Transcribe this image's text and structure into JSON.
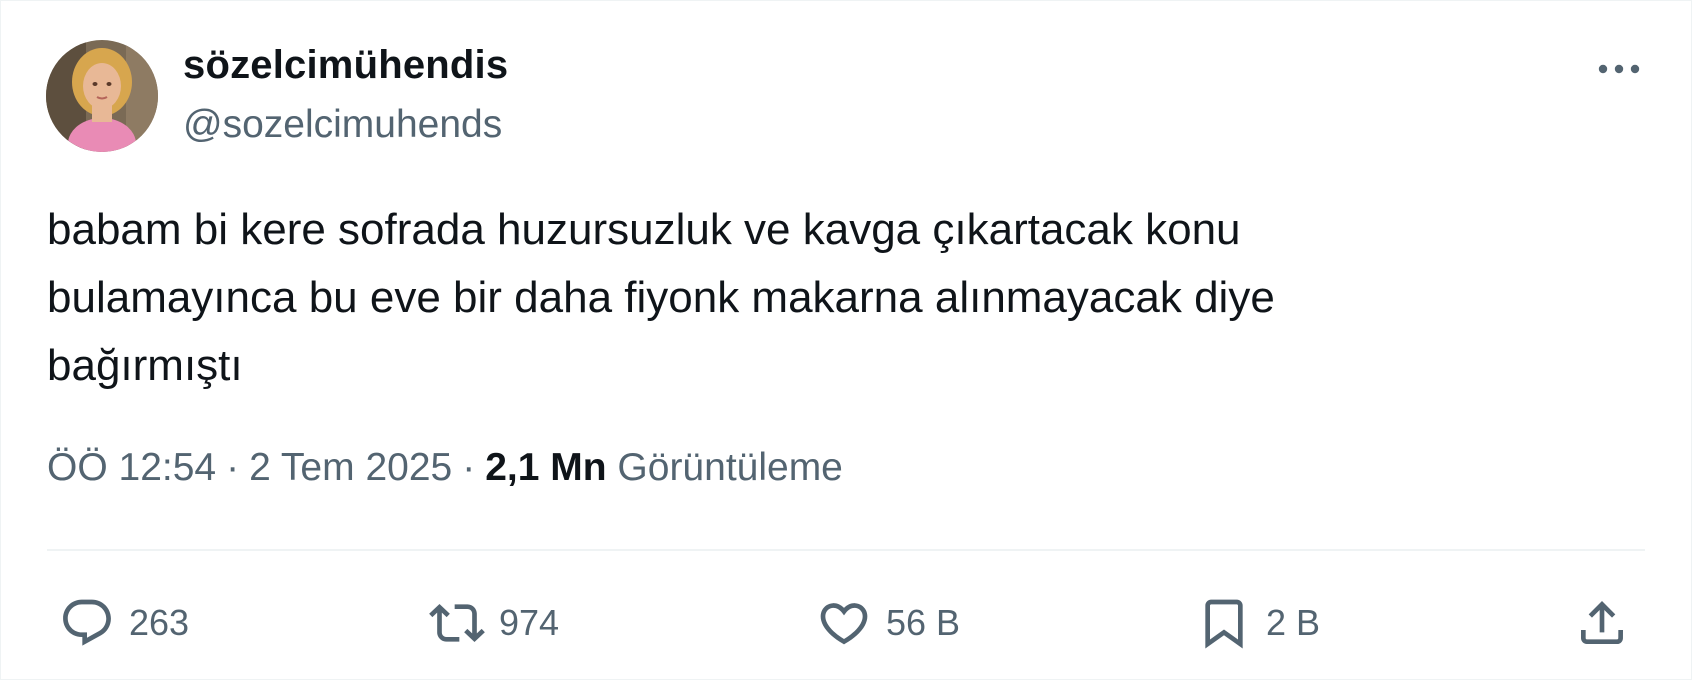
{
  "author": {
    "display_name": "sözelcimühendis",
    "handle": "@sozelcimuhends"
  },
  "tweet": {
    "text_lines": [
      "babam bi kere sofrada huzursuzluk ve kavga çıkartacak konu",
      "bulamayınca bu eve bir daha fiyonk makarna alınmayacak diye",
      "bağırmıştı"
    ],
    "time": "ÖÖ 12:54",
    "date": "2 Tem 2025",
    "separator": "·",
    "views_count": "2,1 Mn",
    "views_label": "Görüntüleme"
  },
  "actions": {
    "replies": "263",
    "reposts": "974",
    "likes": "56 B",
    "bookmarks": "2 B"
  },
  "icons": {
    "more": "more-horizontal-icon",
    "reply": "speech-bubble-icon",
    "repost": "retweet-arrows-icon",
    "like": "heart-icon",
    "bookmark": "bookmark-icon",
    "share": "share-upload-icon"
  },
  "colors": {
    "text_primary": "#0f1419",
    "text_secondary": "#536471",
    "divider": "#eff3f4",
    "background": "#ffffff"
  }
}
